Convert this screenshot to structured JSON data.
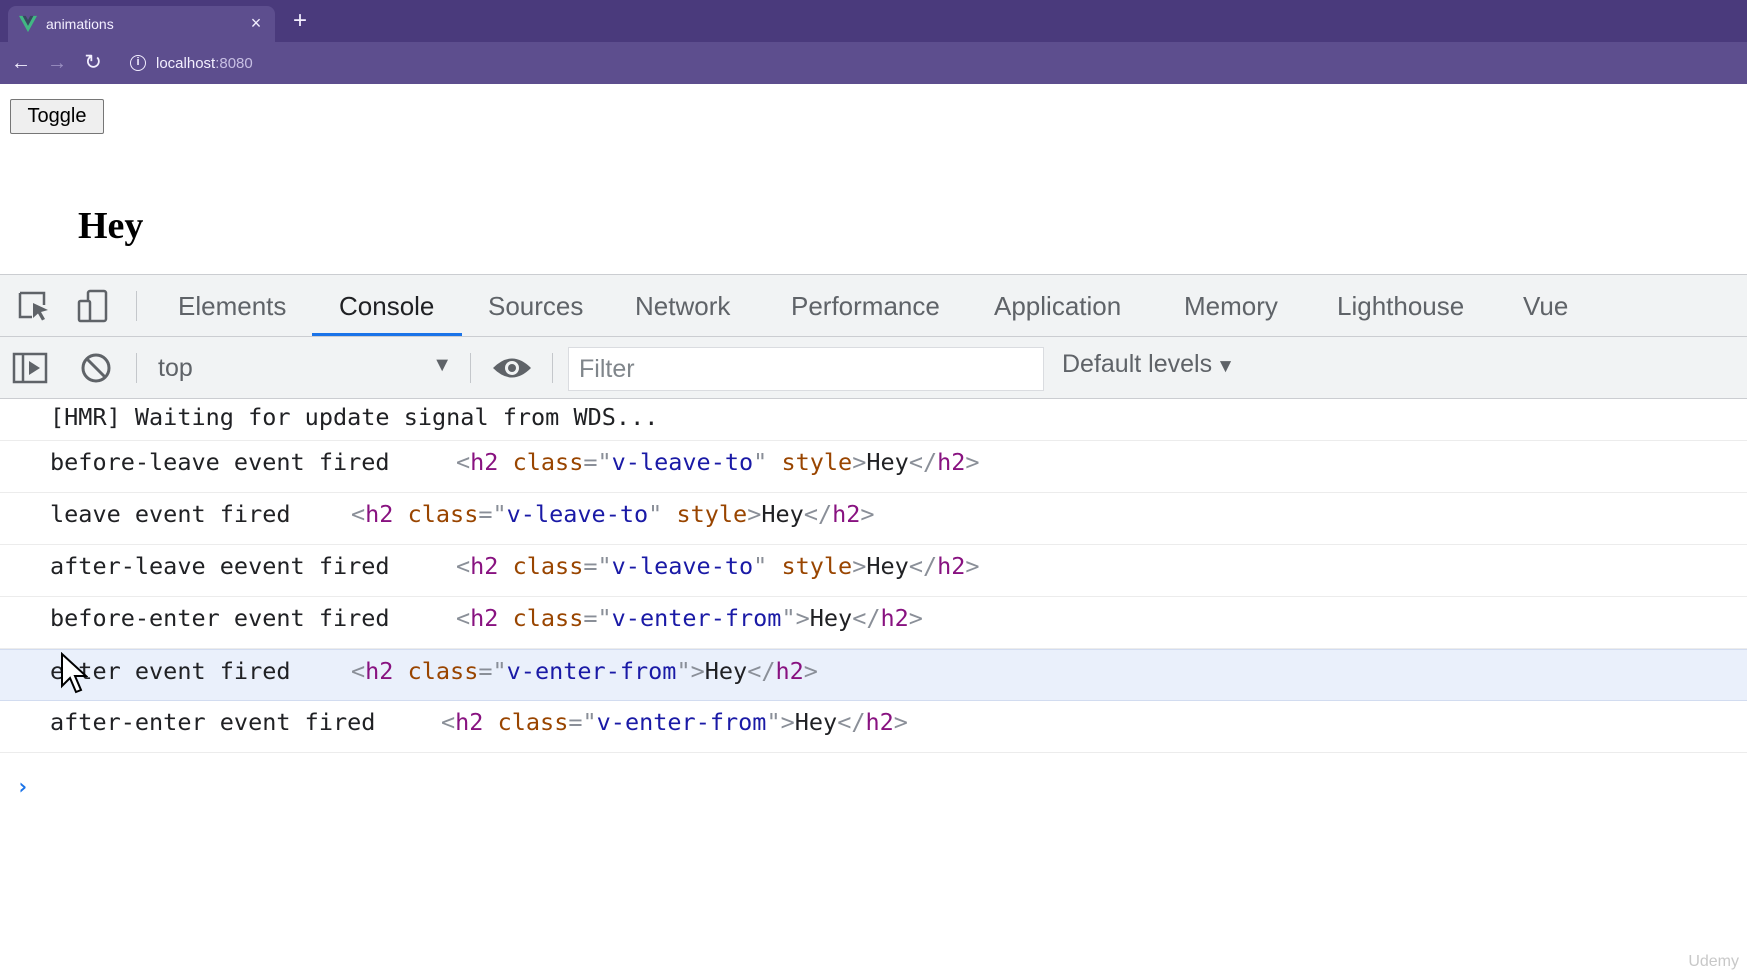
{
  "browser": {
    "tab_title": "animations",
    "tab_close": "×",
    "new_tab": "+",
    "url_host": "localhost",
    "url_port": ":8080",
    "accent": "#4a3a7c"
  },
  "page": {
    "toggle_label": "Toggle",
    "heading": "Hey"
  },
  "devtools": {
    "tabs": [
      "Elements",
      "Console",
      "Sources",
      "Network",
      "Performance",
      "Application",
      "Memory",
      "Lighthouse",
      "Vue"
    ],
    "active_tab": "Console",
    "context": "top",
    "filter_placeholder": "Filter",
    "levels": "Default levels",
    "prompt": "›"
  },
  "console": {
    "hmr": "[HMR] Waiting for update signal from WDS...",
    "messages": [
      {
        "text": "before-leave event fired",
        "cls": "v-leave-to",
        "style_attr": "style",
        "inner": "Hey"
      },
      {
        "text": "leave event fired",
        "cls": "v-leave-to",
        "style_attr": "style",
        "inner": "Hey"
      },
      {
        "text": "after-leave eevent fired",
        "cls": "v-leave-to",
        "style_attr": "style",
        "inner": "Hey"
      },
      {
        "text": "before-enter event fired",
        "cls": "v-enter-from",
        "style_attr": "",
        "inner": "Hey"
      },
      {
        "text": "enter event fired",
        "cls": "v-enter-from",
        "style_attr": "",
        "inner": "Hey"
      },
      {
        "text": "after-enter event fired",
        "cls": "v-enter-from",
        "style_attr": "",
        "inner": "Hey"
      }
    ]
  },
  "watermark": "Udemy"
}
